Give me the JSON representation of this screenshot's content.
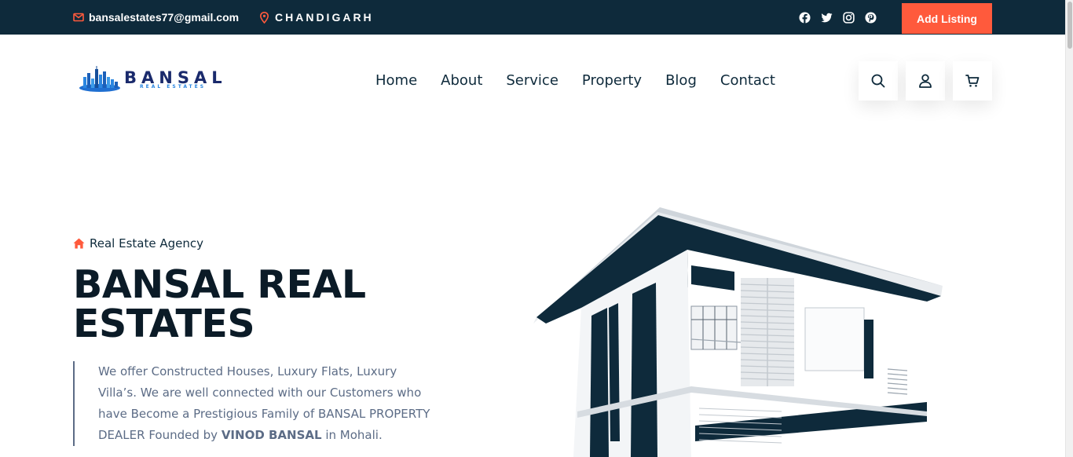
{
  "topbar": {
    "email": "bansalestates77@gmail.com",
    "city": "CHANDIGARH",
    "socials": [
      "facebook-icon",
      "twitter-icon",
      "instagram-icon",
      "pinterest-icon"
    ],
    "add_listing": "Add Listing"
  },
  "header": {
    "logo_name": "BANSAL",
    "logo_sub": "REAL ESTATES",
    "nav": [
      "Home",
      "About",
      "Service",
      "Property",
      "Blog",
      "Contact"
    ],
    "icons": [
      "search-icon",
      "user-icon",
      "cart-icon"
    ]
  },
  "hero": {
    "tagline": "Real Estate Agency",
    "title_line1": "BANSAL REAL",
    "title_line2": "ESTATES",
    "desc_text": "We offer Constructed Houses, Luxury Flats, Luxury Villa’s. We are well connected with our Customers who have Become a Prestigious Family of BANSAL PROPERTY DEALER Founded by",
    "desc_name": "VINOD BANSAL",
    "desc_end": "in Mohali."
  },
  "colors": {
    "dark": "#0e2a3b",
    "accent": "#ff5a3c",
    "text_muted": "#5c6c86"
  }
}
